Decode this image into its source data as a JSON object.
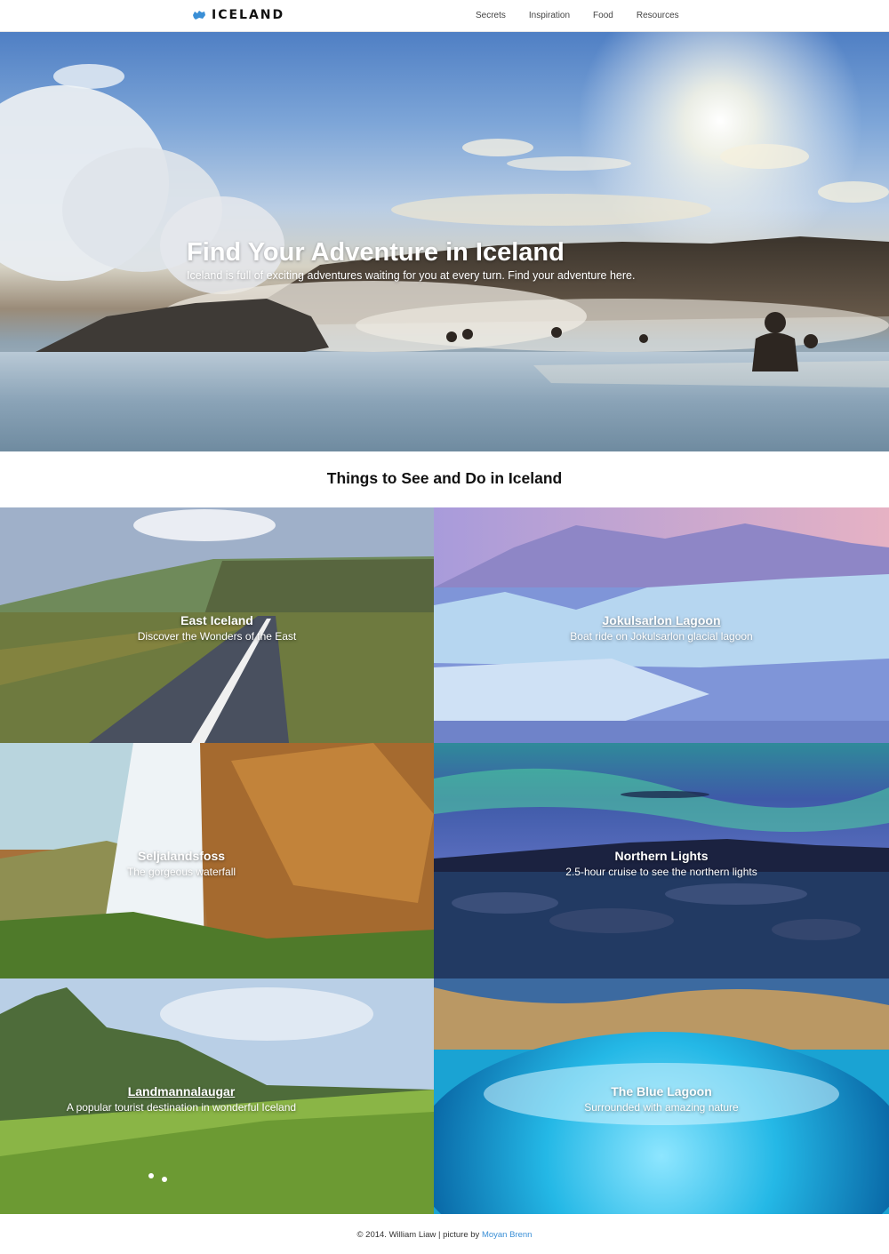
{
  "nav": {
    "brand": "ICELAND",
    "items": [
      "Secrets",
      "Inspiration",
      "Food",
      "Resources"
    ]
  },
  "hero": {
    "title": "Find Your Adventure in Iceland",
    "subtitle": "Iceland is full of exciting adventures waiting for you at every turn. Find your adventure here."
  },
  "section": {
    "title": "Things to See and Do in Iceland"
  },
  "tiles": [
    {
      "title": "East Iceland",
      "desc": "Discover the Wonders of the East"
    },
    {
      "title": "Jokulsarlon Lagoon",
      "desc": "Boat ride on Jokulsarlon glacial lagoon"
    },
    {
      "title": "Seljalandsfoss",
      "desc": "The gorgeous waterfall"
    },
    {
      "title": "Northern Lights",
      "desc": "2.5-hour cruise to see the northern lights"
    },
    {
      "title": "Landmannalaugar",
      "desc": "A popular tourist destination in wonderful Iceland"
    },
    {
      "title": "The Blue Lagoon",
      "desc": "Surrounded with amazing nature"
    }
  ],
  "footer": {
    "text": "© 2014. William Liaw | picture by",
    "link": "Moyan Brenn"
  },
  "colors": {
    "link": "#3a8fd6",
    "nav_text": "#444444"
  }
}
